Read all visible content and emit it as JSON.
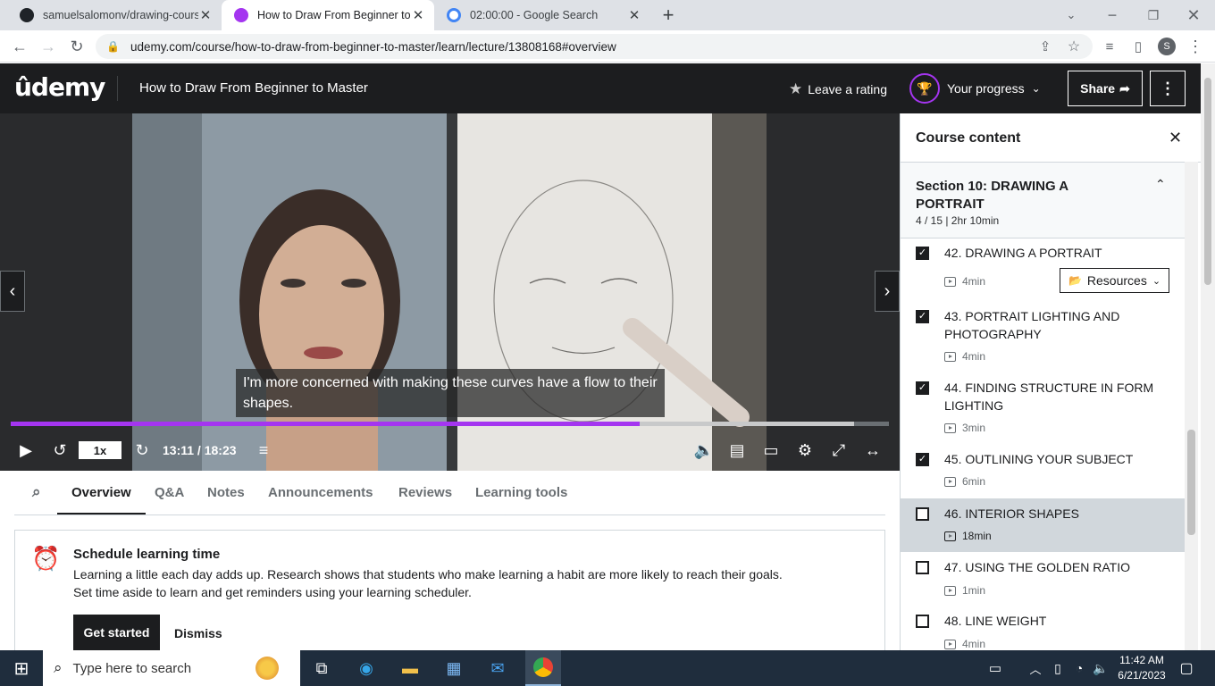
{
  "browser": {
    "tabs": [
      {
        "title": "samuelsalomonv/drawing-course",
        "favicon_color": "#1f2328"
      },
      {
        "title": "How to Draw From Beginner to Master",
        "favicon_color": "#a435f0"
      },
      {
        "title": "02:00:00 - Google Search",
        "favicon_color": "#4285f4"
      }
    ],
    "url": "udemy.com/course/how-to-draw-from-beginner-to-master/learn/lecture/13808168#overview",
    "profile_initial": "S"
  },
  "header": {
    "logo": "ûdemy",
    "course_title": "How to Draw From Beginner to Master",
    "rating_label": "Leave a rating",
    "progress_label": "Your progress",
    "share_label": "Share"
  },
  "video": {
    "subtitle": "I'm more concerned with making these curves have a flow to their shapes.",
    "speed": "1x",
    "time": "13:11 / 18:23",
    "progress_fraction": 0.716,
    "buffered_fraction": 0.96
  },
  "lecture_tabs": [
    "Overview",
    "Q&A",
    "Notes",
    "Announcements",
    "Reviews",
    "Learning tools"
  ],
  "schedule": {
    "title": "Schedule learning time",
    "line1": "Learning a little each day adds up. Research shows that students who make learning a habit are more likely to reach their goals.",
    "line2": "Set time aside to learn and get reminders using your learning scheduler.",
    "primary": "Get started",
    "secondary": "Dismiss"
  },
  "sidebar": {
    "title": "Course content",
    "section_title": "Section 10: DRAWING A PORTRAIT",
    "section_meta": "4 / 15 | 2hr 10min",
    "resources_label": "Resources",
    "items": [
      {
        "title": "42. DRAWING A PORTRAIT",
        "duration": "4min",
        "done": true
      },
      {
        "title": "43. PORTRAIT LIGHTING AND PHOTOGRAPHY",
        "duration": "4min",
        "done": true
      },
      {
        "title": "44. FINDING STRUCTURE IN FORM LIGHTING",
        "duration": "3min",
        "done": true
      },
      {
        "title": "45. OUTLINING YOUR SUBJECT",
        "duration": "6min",
        "done": true
      },
      {
        "title": "46. INTERIOR SHAPES",
        "duration": "18min",
        "done": false,
        "current": true
      },
      {
        "title": "47. USING THE GOLDEN RATIO",
        "duration": "1min",
        "done": false
      },
      {
        "title": "48. LINE WEIGHT",
        "duration": "4min",
        "done": false
      }
    ]
  },
  "taskbar": {
    "search_placeholder": "Type here to search",
    "time": "11:42 AM",
    "date": "6/21/2023"
  },
  "colors": {
    "accent": "#a435f0",
    "header_bg": "#1c1d1f"
  }
}
